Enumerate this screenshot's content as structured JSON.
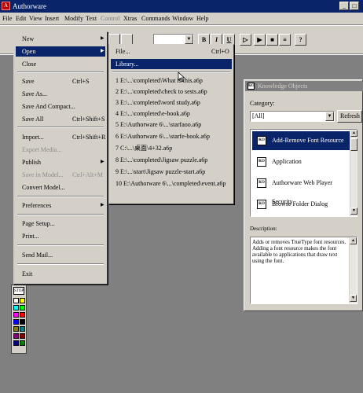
{
  "window": {
    "title": "Authorware",
    "controls": [
      "_",
      "□"
    ]
  },
  "menubar": [
    "File",
    "Edit",
    "View",
    "Insert",
    "Modify",
    "Text",
    "Control",
    "Xtras",
    "Commands",
    "Window",
    "Help"
  ],
  "toolbar": {
    "bold": "B",
    "italic": "I",
    "underline": "U",
    "restart": "▷"
  },
  "file_menu": [
    {
      "label": "New",
      "submenu": true
    },
    {
      "label": "Open",
      "submenu": true,
      "highlighted": true
    },
    {
      "label": "Close"
    },
    {
      "label": "Save",
      "shortcut": "Ctrl+S"
    },
    {
      "label": "Save As..."
    },
    {
      "label": "Save And Compact..."
    },
    {
      "label": "Save All",
      "shortcut": "Ctrl+Shift+S"
    },
    {
      "label": "Import...",
      "shortcut": "Ctrl+Shift+R"
    },
    {
      "label": "Export Media...",
      "disabled": true
    },
    {
      "label": "Publish",
      "submenu": true
    },
    {
      "label": "Save in Model...",
      "shortcut": "Ctrl+Alt+M",
      "disabled": true
    },
    {
      "label": "Convert Model..."
    },
    {
      "label": "Preferences",
      "submenu": true
    },
    {
      "label": "Page Setup..."
    },
    {
      "label": "Print..."
    },
    {
      "label": "Send Mail..."
    },
    {
      "label": "Exit"
    }
  ],
  "open_submenu": [
    {
      "label": "File...",
      "shortcut": "Ctrl+O"
    },
    {
      "label": "Library...",
      "highlighted": true
    },
    {
      "label": "1 E:\\...\\completed\\What is this.a6p"
    },
    {
      "label": "2 E:\\...\\completed\\check to sests.a6p"
    },
    {
      "label": "3 E:\\...\\completed\\word study.a6p"
    },
    {
      "label": "4 E:\\...\\completed\\e-book.a6p"
    },
    {
      "label": "5 E:\\Authorware 6\\...\\starfaoo.a6p"
    },
    {
      "label": "6 E:\\Authorware 6\\...\\starfe-book.a6p"
    },
    {
      "label": "7 C:\\...\\桌面\\4+32.a6p"
    },
    {
      "label": "8 E:\\...\\completed\\Jigsaw puzzle.a6p"
    },
    {
      "label": "9 E:\\...\\start\\Jigsaw puzzle-start.a6p"
    },
    {
      "label": "10 E:\\Authorware 6\\...\\completed\\event.a6p"
    }
  ],
  "knowledge_objects": {
    "title": "Knowledge Objects",
    "category_label": "Category:",
    "category_value": "[All]",
    "refresh_label": "Refresh",
    "items": [
      {
        "label": "Add-Remove Font Resource",
        "selected": true
      },
      {
        "label": "Application"
      },
      {
        "label": "Authorware Web Player Security"
      },
      {
        "label": "Browse Folder Dialog"
      }
    ],
    "description_label": "Description:",
    "description_text": "Adds or removes TrueType font resources. Adding a font resource makes the font available to applications that draw text using the font.",
    "icon_text": "KO"
  },
  "icon_palette": {
    "stop_label": "STOP"
  },
  "colors": {
    "selection": "#0a246a",
    "face": "#d4d0c8",
    "workspace": "#808080"
  }
}
